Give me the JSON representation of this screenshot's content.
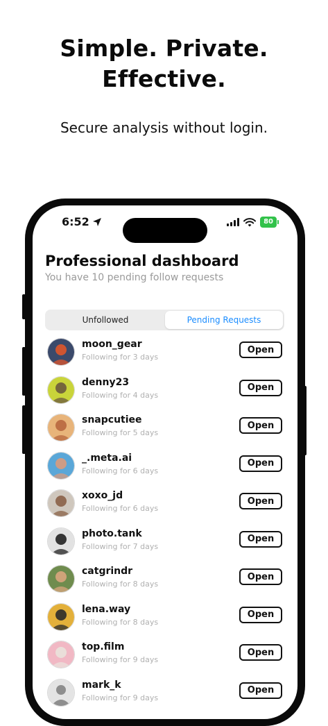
{
  "marketing": {
    "headline_line1": "Simple. Private.",
    "headline_line2": "Effective.",
    "subline": "Secure analysis without login."
  },
  "status_bar": {
    "time": "6:52",
    "battery": "80",
    "icons": [
      "location-arrow-icon",
      "signal-bars-icon",
      "wifi-icon",
      "battery-icon"
    ]
  },
  "dashboard": {
    "title": "Professional dashboard",
    "subtitle": "You have 10 pending follow requests"
  },
  "tabs": [
    {
      "label": "Unfollowed",
      "selected": false
    },
    {
      "label": "Pending Requests",
      "selected": true
    }
  ],
  "colors": {
    "accent": "#1a8cff",
    "battery": "#32c24a"
  },
  "requests": [
    {
      "username": "moon_gear",
      "since": "Following for 3 days",
      "action": "Open",
      "avatar_colors": [
        "#3b4a6b",
        "#e0562b"
      ]
    },
    {
      "username": "denny23",
      "since": "Following for 4 days",
      "action": "Open",
      "avatar_colors": [
        "#c9d43a",
        "#6b5a3d"
      ]
    },
    {
      "username": "snapcutiee",
      "since": "Following for 5 days",
      "action": "Open",
      "avatar_colors": [
        "#e8b47a",
        "#b8673f"
      ]
    },
    {
      "username": "_.meta.ai",
      "since": "Following for 6 days",
      "action": "Open",
      "avatar_colors": [
        "#5aa7d8",
        "#d99b7d"
      ]
    },
    {
      "username": "xoxo_jd",
      "since": "Following for 6 days",
      "action": "Open",
      "avatar_colors": [
        "#cfc7bd",
        "#8a6147"
      ]
    },
    {
      "username": "photo.tank",
      "since": "Following for 7 days",
      "action": "Open",
      "avatar_colors": [
        "#e2e2e2",
        "#222222"
      ]
    },
    {
      "username": "catgrindr",
      "since": "Following for 8 days",
      "action": "Open",
      "avatar_colors": [
        "#6f8c4e",
        "#d9a57e"
      ]
    },
    {
      "username": "lena.way",
      "since": "Following for 8 days",
      "action": "Open",
      "avatar_colors": [
        "#e3b03a",
        "#2b2b2b"
      ]
    },
    {
      "username": "top.film",
      "since": "Following for 9 days",
      "action": "Open",
      "avatar_colors": [
        "#f1b8c4",
        "#e9e2dc"
      ]
    },
    {
      "username": "mark_k",
      "since": "Following for 9 days",
      "action": "Open",
      "avatar_colors": [
        "#e4e4e4",
        "#8e8e8e"
      ]
    }
  ]
}
